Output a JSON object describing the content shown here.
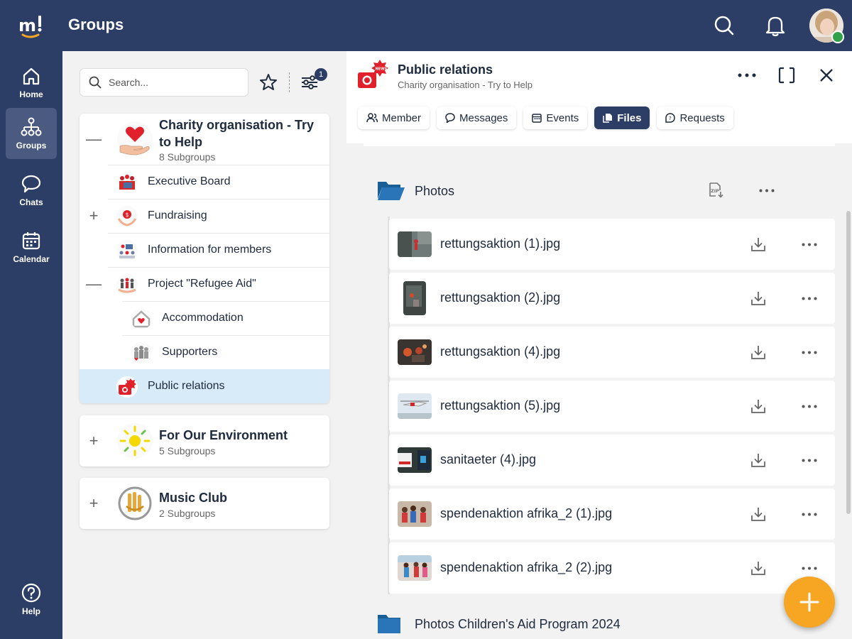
{
  "topbar": {
    "title": "Groups",
    "search_icon": "search-icon",
    "bell_icon": "bell-icon",
    "avatar_status": "online"
  },
  "nav": {
    "items": [
      {
        "label": "Home",
        "icon": "home-icon"
      },
      {
        "label": "Groups",
        "icon": "groups-icon",
        "active": true
      },
      {
        "label": "Chats",
        "icon": "chat-icon"
      },
      {
        "label": "Calendar",
        "icon": "calendar-icon"
      }
    ],
    "help": {
      "label": "Help",
      "icon": "help-icon"
    }
  },
  "groups_panel": {
    "search_placeholder": "Search...",
    "filter_count": "1",
    "groups": [
      {
        "name": "Charity organisation - Try to Help",
        "subgroups_label": "8 Subgroups",
        "expanded": true,
        "children": [
          {
            "label": "Executive Board"
          },
          {
            "label": "Fundraising",
            "expandable": true
          },
          {
            "label": "Information for members"
          },
          {
            "label": "Project \"Refugee Aid\"",
            "expanded": true
          },
          {
            "label": "Accommodation"
          },
          {
            "label": "Supporters"
          },
          {
            "label": "Public relations",
            "selected": true
          }
        ]
      },
      {
        "name": "For Our Environment",
        "subgroups_label": "5 Subgroups"
      },
      {
        "name": "Music Club",
        "subgroups_label": "2 Subgroups"
      }
    ]
  },
  "detail": {
    "title": "Public relations",
    "subtitle": "Charity organisation - Try to Help",
    "tabs": [
      {
        "label": "Member",
        "icon": "member-icon"
      },
      {
        "label": "Messages",
        "icon": "message-icon"
      },
      {
        "label": "Events",
        "icon": "calendar-icon"
      },
      {
        "label": "Files",
        "icon": "files-icon",
        "active": true
      },
      {
        "label": "Requests",
        "icon": "requests-icon"
      }
    ],
    "folders": [
      {
        "name": "Photos",
        "open": true
      },
      {
        "name": "Photos Children's Aid Program 2024",
        "open": false
      }
    ],
    "files": [
      {
        "name": "rettungsaktion (1).jpg"
      },
      {
        "name": "rettungsaktion (2).jpg"
      },
      {
        "name": "rettungsaktion (4).jpg"
      },
      {
        "name": "rettungsaktion (5).jpg"
      },
      {
        "name": "sanitaeter (4).jpg"
      },
      {
        "name": "spendenaktion afrika_2 (1).jpg"
      },
      {
        "name": "spendenaktion afrika_2 (2).jpg"
      }
    ]
  },
  "colors": {
    "primary": "#2d3e66",
    "selected_row": "#d8ebf8",
    "fab": "#f6a623",
    "accent_red": "#e0202a"
  }
}
